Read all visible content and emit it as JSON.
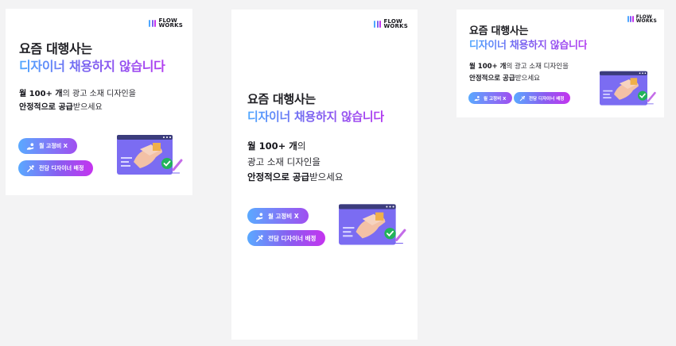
{
  "brand": {
    "line1": "FLOW",
    "line2": "WORKS"
  },
  "headline": {
    "line1": "요즘 대행사는",
    "line2": "디자이너 채용하지 않습니다"
  },
  "body": {
    "monthly_bold": "월 100+ 개",
    "monthly_rest": "의 광고 소재 디자인을",
    "monthly_rest_wide": "의",
    "design_line": "광고 소재 디자인을",
    "stable_bold": "안정적으로 공급",
    "stable_rest": "받으세요"
  },
  "pills": {
    "fixed_cost": "월 고정비 X",
    "designer": "전담 디자이너 배정"
  },
  "icons": [
    "hand-coin-icon",
    "tools-icon",
    "handshake-illustration",
    "check-badge-icon",
    "pencil-icon"
  ],
  "colors": {
    "gradient_start": "#5aa9ff",
    "gradient_mid": "#8a5cf0",
    "gradient_end": "#c534ef",
    "check_green": "#22b45a"
  }
}
